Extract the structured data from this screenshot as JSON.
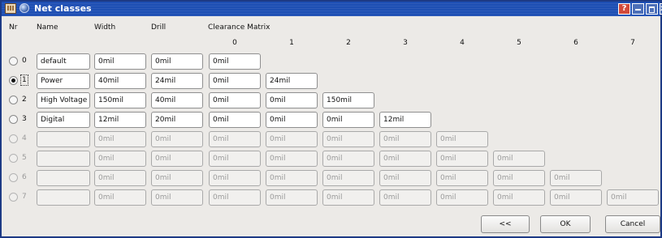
{
  "window": {
    "title": "Net classes",
    "help_glyph": "?",
    "close_glyph": "x"
  },
  "headers": {
    "nr": "Nr",
    "name": "Name",
    "width": "Width",
    "drill": "Drill",
    "clearance": "Clearance Matrix"
  },
  "matrix_columns": [
    "0",
    "1",
    "2",
    "3",
    "4",
    "5",
    "6",
    "7"
  ],
  "rows": [
    {
      "nr": "0",
      "selected": false,
      "enabled": true,
      "name": "default",
      "width": "0mil",
      "drill": "0mil",
      "clearance": [
        "0mil"
      ]
    },
    {
      "nr": "1",
      "selected": true,
      "enabled": true,
      "name": "Power",
      "width": "40mil",
      "drill": "24mil",
      "clearance": [
        "0mil",
        "24mil"
      ]
    },
    {
      "nr": "2",
      "selected": false,
      "enabled": true,
      "name": "High Voltage",
      "width": "150mil",
      "drill": "40mil",
      "clearance": [
        "0mil",
        "0mil",
        "150mil"
      ]
    },
    {
      "nr": "3",
      "selected": false,
      "enabled": true,
      "name": "Digital",
      "width": "12mil",
      "drill": "20mil",
      "clearance": [
        "0mil",
        "0mil",
        "0mil",
        "12mil"
      ]
    },
    {
      "nr": "4",
      "selected": false,
      "enabled": false,
      "name": "",
      "width": "0mil",
      "drill": "0mil",
      "clearance": [
        "0mil",
        "0mil",
        "0mil",
        "0mil",
        "0mil"
      ]
    },
    {
      "nr": "5",
      "selected": false,
      "enabled": false,
      "name": "",
      "width": "0mil",
      "drill": "0mil",
      "clearance": [
        "0mil",
        "0mil",
        "0mil",
        "0mil",
        "0mil",
        "0mil"
      ]
    },
    {
      "nr": "6",
      "selected": false,
      "enabled": false,
      "name": "",
      "width": "0mil",
      "drill": "0mil",
      "clearance": [
        "0mil",
        "0mil",
        "0mil",
        "0mil",
        "0mil",
        "0mil",
        "0mil"
      ]
    },
    {
      "nr": "7",
      "selected": false,
      "enabled": false,
      "name": "",
      "width": "0mil",
      "drill": "0mil",
      "clearance": [
        "0mil",
        "0mil",
        "0mil",
        "0mil",
        "0mil",
        "0mil",
        "0mil",
        "0mil"
      ]
    }
  ],
  "buttons": {
    "back": "<<",
    "ok": "OK",
    "cancel": "Cancel"
  },
  "colors": {
    "titlebar": "#1e4fb4",
    "dialog_bg": "#eceae7",
    "field_border": "#8f8f8f"
  }
}
